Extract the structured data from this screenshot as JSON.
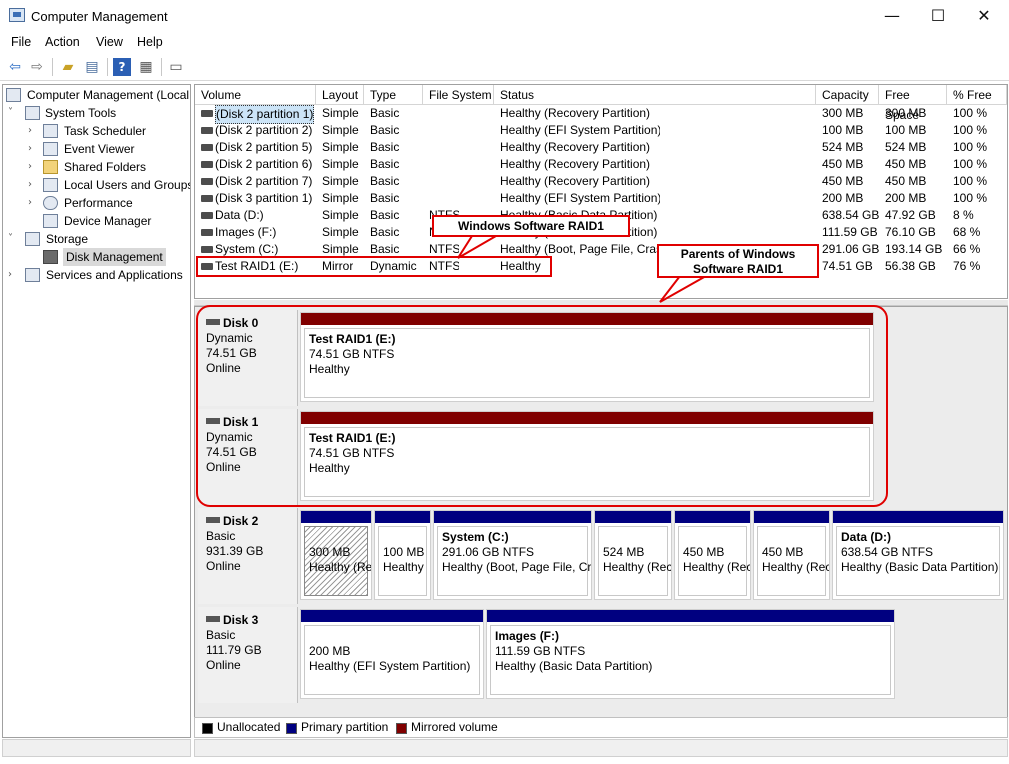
{
  "window": {
    "title": "Computer Management",
    "minimize_glyph": "—",
    "maximize_glyph": "☐",
    "close_glyph": "✕"
  },
  "menu": {
    "file": "File",
    "action": "Action",
    "view": "View",
    "help": "Help"
  },
  "toolbar_icons": [
    "back-icon",
    "forward-icon",
    "up-folder-icon",
    "show-hide-tree-icon",
    "help-icon",
    "properties-icon",
    "console-icon"
  ],
  "tree": {
    "root": "Computer Management (Local",
    "system_tools": "System Tools",
    "task_scheduler": "Task Scheduler",
    "event_viewer": "Event Viewer",
    "shared_folders": "Shared Folders",
    "local_users": "Local Users and Groups",
    "performance": "Performance",
    "device_manager": "Device Manager",
    "storage": "Storage",
    "disk_management": "Disk Management",
    "services": "Services and Applications"
  },
  "columns": {
    "volume": "Volume",
    "layout": "Layout",
    "type": "Type",
    "fs": "File System",
    "status": "Status",
    "capacity": "Capacity",
    "free": "Free Space",
    "pct": "% Free"
  },
  "volumes": [
    {
      "volume": "(Disk 2 partition 1)",
      "layout": "Simple",
      "type": "Basic",
      "fs": "",
      "status": "Healthy (Recovery Partition)",
      "capacity": "300 MB",
      "free": "300 MB",
      "pct": "100 %"
    },
    {
      "volume": "(Disk 2 partition 2)",
      "layout": "Simple",
      "type": "Basic",
      "fs": "",
      "status": "Healthy (EFI System Partition)",
      "capacity": "100 MB",
      "free": "100 MB",
      "pct": "100 %"
    },
    {
      "volume": "(Disk 2 partition 5)",
      "layout": "Simple",
      "type": "Basic",
      "fs": "",
      "status": "Healthy (Recovery Partition)",
      "capacity": "524 MB",
      "free": "524 MB",
      "pct": "100 %"
    },
    {
      "volume": "(Disk 2 partition 6)",
      "layout": "Simple",
      "type": "Basic",
      "fs": "",
      "status": "Healthy (Recovery Partition)",
      "capacity": "450 MB",
      "free": "450 MB",
      "pct": "100 %"
    },
    {
      "volume": "(Disk 2 partition 7)",
      "layout": "Simple",
      "type": "Basic",
      "fs": "",
      "status": "Healthy (Recovery Partition)",
      "capacity": "450 MB",
      "free": "450 MB",
      "pct": "100 %"
    },
    {
      "volume": "(Disk 3 partition 1)",
      "layout": "Simple",
      "type": "Basic",
      "fs": "",
      "status": "Healthy (EFI System Partition)",
      "capacity": "200 MB",
      "free": "200 MB",
      "pct": "100 %"
    },
    {
      "volume": "Data (D:)",
      "layout": "Simple",
      "type": "Basic",
      "fs": "NTFS",
      "status": "Healthy (Basic Data Partition)",
      "capacity": "638.54 GB",
      "free": "47.92 GB",
      "pct": "8 %"
    },
    {
      "volume": "Images (F:)",
      "layout": "Simple",
      "type": "Basic",
      "fs": "NTFS",
      "status": "Healthy (Basic Data Partition)",
      "capacity": "111.59 GB",
      "free": "76.10 GB",
      "pct": "68 %"
    },
    {
      "volume": "System (C:)",
      "layout": "Simple",
      "type": "Basic",
      "fs": "NTFS",
      "status": "Healthy (Boot, Page File, Crash Dump, Basic Data Partition)",
      "capacity": "291.06 GB",
      "free": "193.14 GB",
      "pct": "66 %"
    },
    {
      "volume": "Test RAID1 (E:)",
      "layout": "Mirror",
      "type": "Dynamic",
      "fs": "NTFS",
      "status": "Healthy",
      "capacity": "74.51 GB",
      "free": "56.38 GB",
      "pct": "76 %"
    }
  ],
  "disks": {
    "d0": {
      "name": "Disk 0",
      "type": "Dynamic",
      "size": "74.51 GB",
      "state": "Online"
    },
    "d1": {
      "name": "Disk 1",
      "type": "Dynamic",
      "size": "74.51 GB",
      "state": "Online"
    },
    "d2": {
      "name": "Disk 2",
      "type": "Basic",
      "size": "931.39 GB",
      "state": "Online"
    },
    "d3": {
      "name": "Disk 3",
      "type": "Basic",
      "size": "111.79 GB",
      "state": "Online"
    }
  },
  "parts": {
    "d0p1": {
      "name": "Test RAID1  (E:)",
      "size": "74.51 GB NTFS",
      "status": "Healthy"
    },
    "d1p1": {
      "name": "Test RAID1  (E:)",
      "size": "74.51 GB NTFS",
      "status": "Healthy"
    },
    "d2p1": {
      "size": "300 MB",
      "status": "Healthy (Recovery Partition)"
    },
    "d2p2": {
      "size": "100 MB",
      "status": "Healthy"
    },
    "d2p3": {
      "name": "System  (C:)",
      "size": "291.06 GB NTFS",
      "status": "Healthy (Boot, Page File, Crash Dump, Basic Data Partition)"
    },
    "d2p4": {
      "size": "524 MB",
      "status": "Healthy (Recovery Partition)"
    },
    "d2p5": {
      "size": "450 MB",
      "status": "Healthy (Recovery Partition)"
    },
    "d2p6": {
      "size": "450 MB",
      "status": "Healthy (Recovery Partition)"
    },
    "d2p7": {
      "name": "Data  (D:)",
      "size": "638.54 GB NTFS",
      "status": "Healthy (Basic Data Partition)"
    },
    "d3p1": {
      "size": "200 MB",
      "status": "Healthy (EFI System Partition)"
    },
    "d3p2": {
      "name": "Images  (F:)",
      "size": "111.59 GB NTFS",
      "status": "Healthy (Basic Data Partition)"
    }
  },
  "legend": {
    "unallocated": "Unallocated",
    "primary": "Primary partition",
    "mirrored": "Mirrored volume"
  },
  "colors": {
    "primary": "#000080",
    "mirrored": "#800000",
    "unallocated": "#000000",
    "annotation": "#e00000"
  },
  "annotations": {
    "raid1": "Windows Software RAID1",
    "parents_line1": "Parents of Windows",
    "parents_line2": "Software RAID1"
  }
}
